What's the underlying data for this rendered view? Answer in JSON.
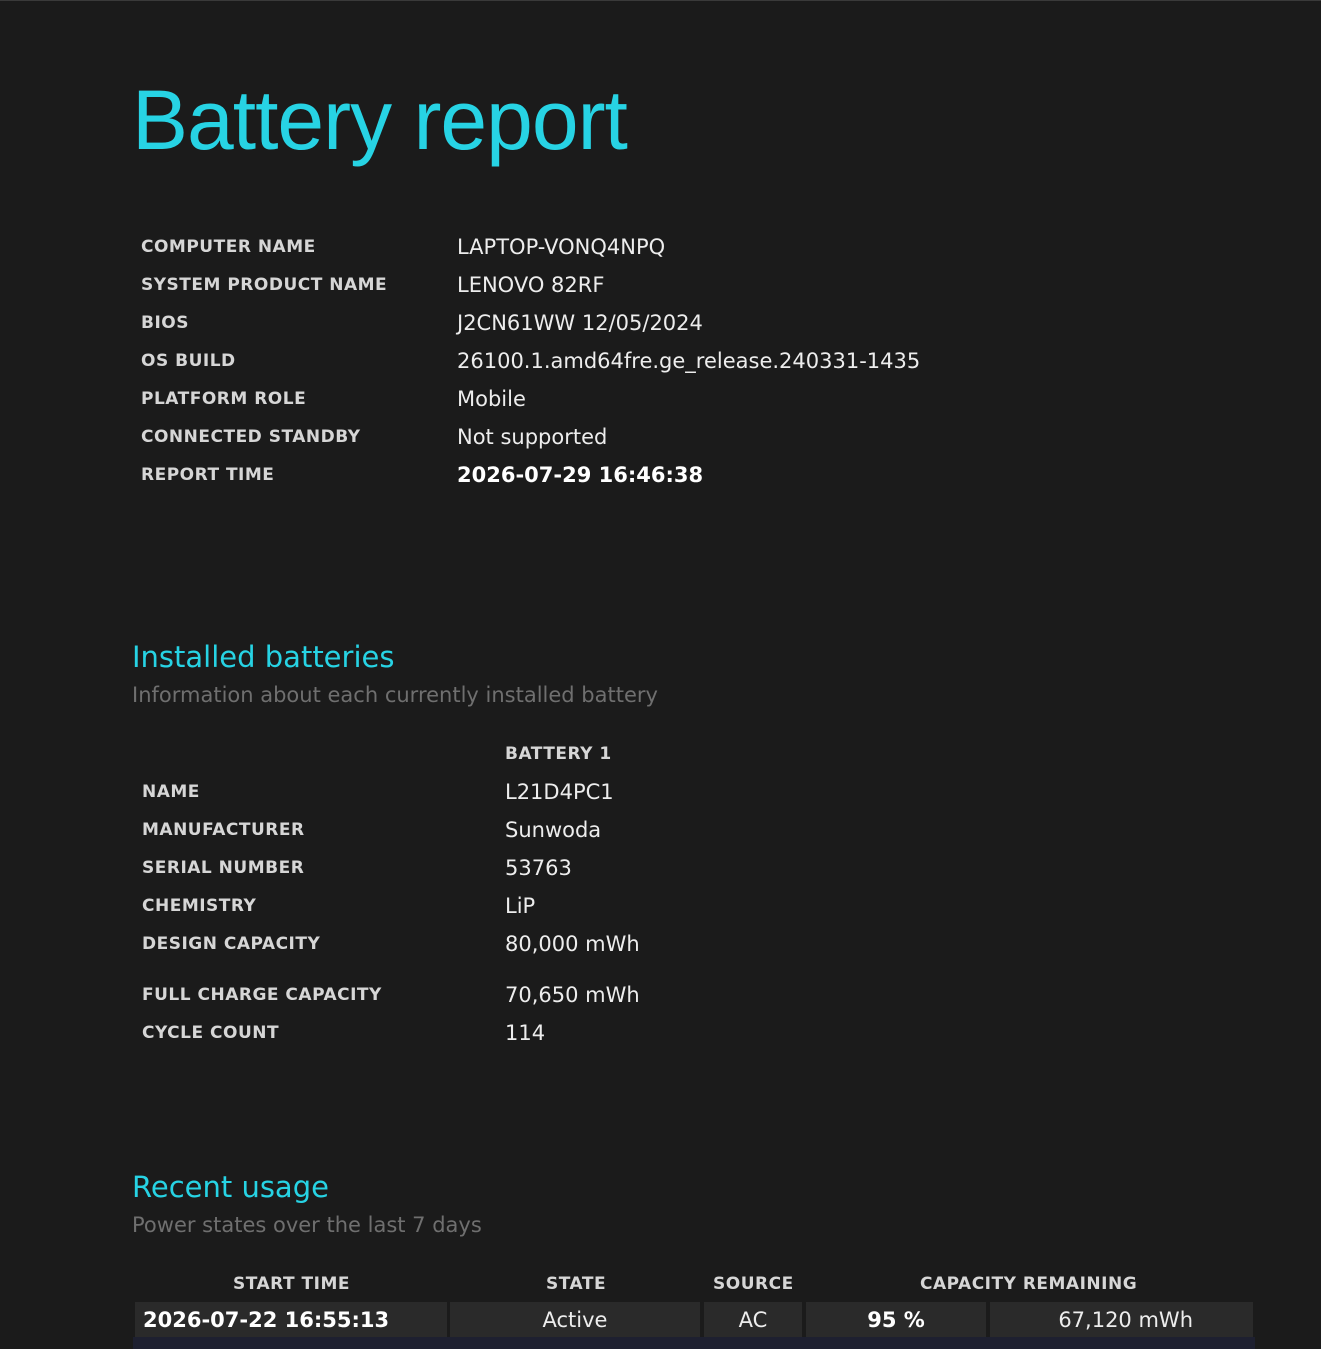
{
  "title": "Battery report",
  "system_info": [
    {
      "key": "COMPUTER NAME",
      "value": "LAPTOP-VONQ4NPQ"
    },
    {
      "key": "SYSTEM PRODUCT NAME",
      "value": "LENOVO 82RF"
    },
    {
      "key": "BIOS",
      "value": "J2CN61WW 12/05/2024"
    },
    {
      "key": "OS BUILD",
      "value": "26100.1.amd64fre.ge_release.240331-1435"
    },
    {
      "key": "PLATFORM ROLE",
      "value": "Mobile"
    },
    {
      "key": "CONNECTED STANDBY",
      "value": "Not supported"
    },
    {
      "key": "REPORT TIME",
      "value": "2026-07-29  16:46:38"
    }
  ],
  "installed_batteries": {
    "title": "Installed batteries",
    "subtitle": "Information about each currently installed battery",
    "column_header": "BATTERY 1",
    "rows": [
      {
        "key": "NAME",
        "value": "L21D4PC1"
      },
      {
        "key": "MANUFACTURER",
        "value": "Sunwoda"
      },
      {
        "key": "SERIAL NUMBER",
        "value": "53763"
      },
      {
        "key": "CHEMISTRY",
        "value": "LiP"
      },
      {
        "key": "DESIGN CAPACITY",
        "value": "80,000 mWh"
      },
      {
        "key": "FULL CHARGE CAPACITY",
        "value": "70,650 mWh"
      },
      {
        "key": "CYCLE COUNT",
        "value": "114"
      }
    ]
  },
  "recent_usage": {
    "title": "Recent usage",
    "subtitle": "Power states over the last 7 days",
    "headers": {
      "start_time": "START TIME",
      "state": "STATE",
      "source": "SOURCE",
      "capacity_remaining": "CAPACITY REMAINING"
    },
    "rows": [
      {
        "start_time": "2026-07-22  16:55:13",
        "state": "Active",
        "source": "AC",
        "percent": "95 %",
        "mwh": "67,120 mWh"
      }
    ]
  }
}
